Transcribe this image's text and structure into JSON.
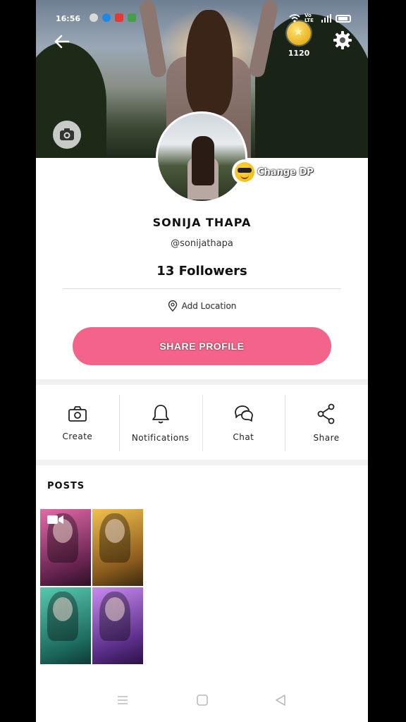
{
  "status_bar": {
    "time": "16:56",
    "network": "Vo LTE"
  },
  "header": {
    "coin_count": "1120",
    "change_dp_label": "Change DP"
  },
  "profile": {
    "name": "SONIJA THAPA",
    "handle": "@sonijathapa",
    "followers": "13 Followers",
    "location_label": "Add Location",
    "share_button_label": "SHARE PROFILE"
  },
  "actions": [
    {
      "label": "Create",
      "icon": "camera-outline-icon"
    },
    {
      "label": "Notifications",
      "icon": "bell-icon"
    },
    {
      "label": "Chat",
      "icon": "chat-bubbles-icon"
    },
    {
      "label": "Share",
      "icon": "share-icon"
    }
  ],
  "posts": {
    "title": "POSTS"
  },
  "colors": {
    "accent_pink": "#f4638a",
    "background": "#ffffff",
    "frame": "#000000"
  }
}
